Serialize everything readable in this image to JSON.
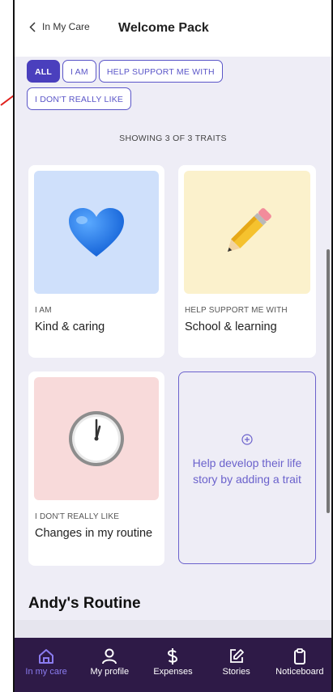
{
  "header": {
    "back_label": "In My Care",
    "title": "Welcome Pack"
  },
  "filters": [
    {
      "label": "ALL",
      "active": true
    },
    {
      "label": "I AM",
      "active": false
    },
    {
      "label": "HELP SUPPORT ME WITH",
      "active": false
    },
    {
      "label": "I DON'T REALLY LIKE",
      "active": false
    }
  ],
  "showing": "SHOWING 3 OF 3 TRAITS",
  "traits": [
    {
      "category": "I AM",
      "name": "Kind & caring",
      "icon": "blue-heart-icon",
      "bg": "#cfe0fb"
    },
    {
      "category": "HELP SUPPORT ME WITH",
      "name": "School & learning",
      "icon": "pencil-icon",
      "bg": "#fbf1cc"
    },
    {
      "category": "I DON'T REALLY LIKE",
      "name": "Changes in my routine",
      "icon": "clock-icon",
      "bg": "#f8dada"
    }
  ],
  "add_trait": {
    "text": "Help develop their life story by adding a trait"
  },
  "routine_title": "Andy's Routine",
  "tabs": [
    {
      "label": "In my care",
      "icon": "home-icon",
      "active": true
    },
    {
      "label": "My profile",
      "icon": "person-icon",
      "active": false
    },
    {
      "label": "Expenses",
      "icon": "dollar-icon",
      "active": false
    },
    {
      "label": "Stories",
      "icon": "edit-icon",
      "active": false
    },
    {
      "label": "Noticeboard",
      "icon": "clipboard-icon",
      "active": false
    }
  ],
  "colors": {
    "accent": "#5b56c8",
    "tabbar": "#2e1a47",
    "active_tab": "#8b7cf0",
    "annotation": "#e0201c"
  }
}
